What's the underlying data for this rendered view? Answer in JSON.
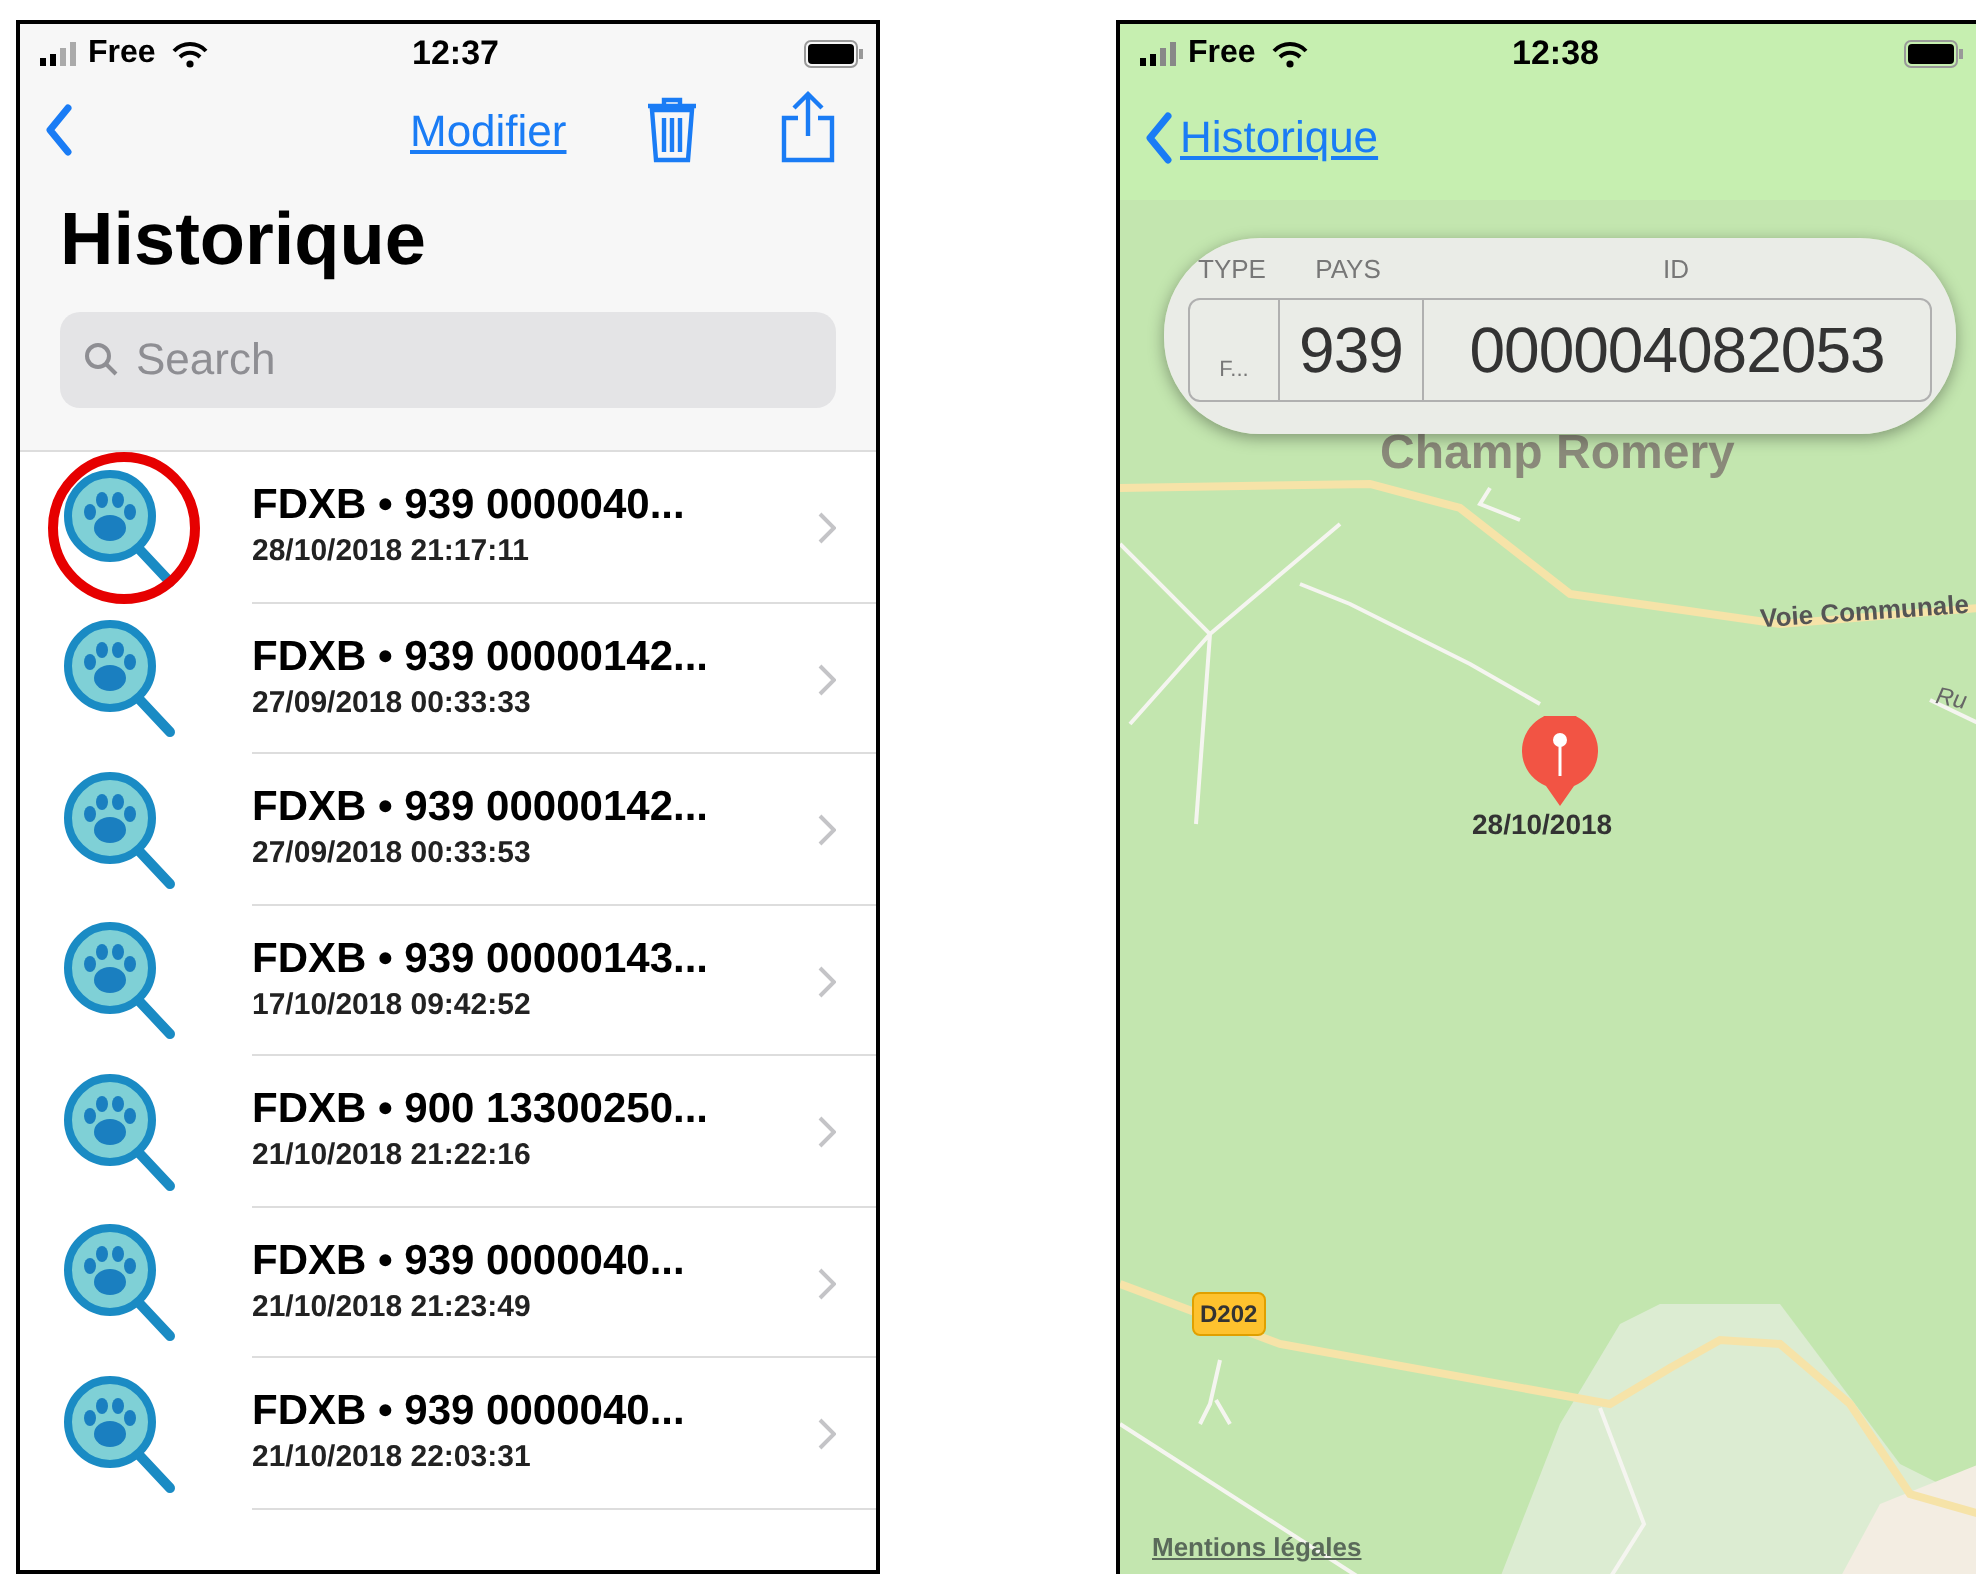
{
  "list_screen": {
    "status_bar": {
      "carrier": "Free",
      "time": "12:37"
    },
    "nav": {
      "edit_label": "Modifier"
    },
    "title": "Historique",
    "search": {
      "placeholder": "Search"
    },
    "items": [
      {
        "title": "FDXB • 939 0000040...",
        "date": "28/10/2018 21:17:11",
        "highlighted": true
      },
      {
        "title": "FDXB • 939 00000142...",
        "date": "27/09/2018 00:33:33",
        "highlighted": false
      },
      {
        "title": "FDXB • 939 00000142...",
        "date": "27/09/2018 00:33:53",
        "highlighted": false
      },
      {
        "title": "FDXB • 939 00000143...",
        "date": "17/10/2018 09:42:52",
        "highlighted": false
      },
      {
        "title": "FDXB • 900 13300250...",
        "date": "21/10/2018 21:22:16",
        "highlighted": false
      },
      {
        "title": "FDXB • 939 0000040...",
        "date": "21/10/2018 21:23:49",
        "highlighted": false
      },
      {
        "title": "FDXB • 939 0000040...",
        "date": "21/10/2018 22:03:31",
        "highlighted": false
      }
    ]
  },
  "map_screen": {
    "status_bar": {
      "carrier": "Free",
      "time": "12:38"
    },
    "nav": {
      "back_label": "Historique"
    },
    "chip_card": {
      "columns": [
        {
          "header": "TYPE",
          "value": "F..."
        },
        {
          "header": "PAYS",
          "value": "939"
        },
        {
          "header": "ID",
          "value": "000004082053"
        }
      ]
    },
    "map_labels": [
      {
        "kind": "place",
        "text": "Champ Romery"
      },
      {
        "kind": "road",
        "text": "Voie Communale"
      },
      {
        "kind": "road-italic",
        "text": "Ru"
      },
      {
        "kind": "route-badge",
        "text": "D202"
      }
    ],
    "pin": {
      "label": "28/10/2018"
    },
    "legal_link": "Mentions légales"
  }
}
